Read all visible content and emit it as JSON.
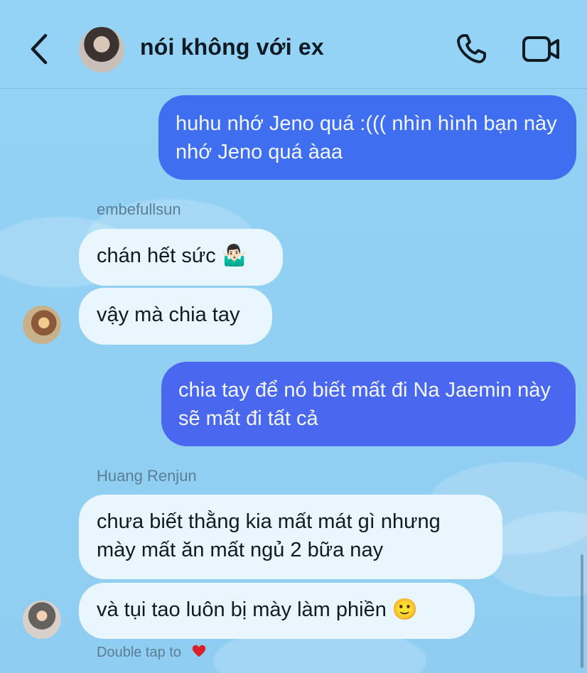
{
  "header": {
    "title": "nói không với ex"
  },
  "messages": [
    {
      "side": "outgoing",
      "text": "huhu nhớ Jeno quá :((( nhìn hình bạn này nhớ Jeno quá àaa"
    },
    {
      "side": "incoming",
      "sender": "embefullsun",
      "text": "chán hết sức 🤷🏻‍♂️"
    },
    {
      "side": "incoming",
      "text": "vậy mà chia tay"
    },
    {
      "side": "outgoing",
      "text": "chia tay để nó biết mất đi Na Jaemin này sẽ mất đi tất cả"
    },
    {
      "side": "incoming",
      "sender": "Huang Renjun",
      "text": "chưa biết thằng kia mất mát gì nhưng mày mất ăn mất ngủ 2 bữa nay"
    },
    {
      "side": "incoming",
      "text": "và tụi tao luôn bị mày làm phiền 🙂"
    }
  ],
  "footer": {
    "hint": "Double tap to"
  },
  "colors": {
    "background": "#93d2f4",
    "outgoing_bubble": "#3f6ff0",
    "incoming_bubble": "#eaf6fe"
  },
  "icons": [
    "back-chevron-icon",
    "phone-icon",
    "video-icon",
    "heart-icon"
  ]
}
